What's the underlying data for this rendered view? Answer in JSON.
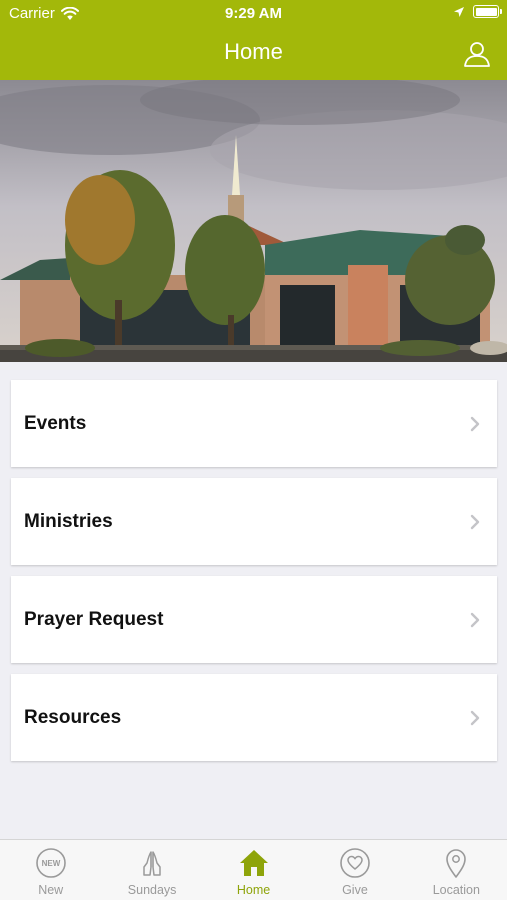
{
  "status_bar": {
    "carrier": "Carrier",
    "time": "9:29 AM"
  },
  "header": {
    "title": "Home",
    "background": "#a3b80a"
  },
  "menu": {
    "items": [
      {
        "label": "Events"
      },
      {
        "label": "Ministries"
      },
      {
        "label": "Prayer Request"
      },
      {
        "label": "Resources"
      }
    ]
  },
  "tabbar": {
    "active_color": "#8ea40a",
    "tabs": [
      {
        "label": "New",
        "badge": "NEW",
        "icon": "new-badge-icon"
      },
      {
        "label": "Sundays",
        "icon": "praying-hands-icon"
      },
      {
        "label": "Home",
        "icon": "home-icon",
        "active": true
      },
      {
        "label": "Give",
        "icon": "heart-circle-icon"
      },
      {
        "label": "Location",
        "icon": "location-pin-icon"
      }
    ]
  }
}
